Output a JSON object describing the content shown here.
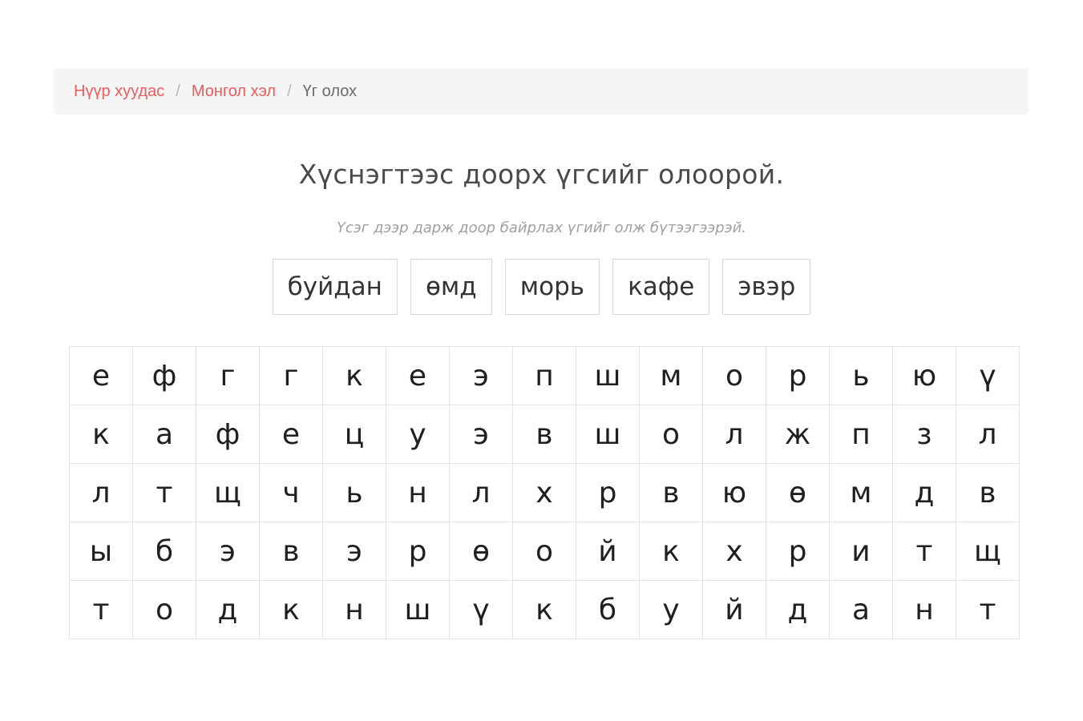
{
  "breadcrumb": {
    "items": [
      {
        "label": "Нүүр хуудас"
      },
      {
        "label": "Монгол хэл"
      }
    ],
    "separator": "/",
    "current": "Үг олох"
  },
  "title": "Хүснэгтээс доорх үгсийг олоорой.",
  "subtitle": "Үсэг дээр дарж доор байрлах үгийг олж бүтээгээрэй.",
  "words": [
    "буйдан",
    "өмд",
    "морь",
    "кафе",
    "эвэр"
  ],
  "grid": [
    [
      "е",
      "ф",
      "г",
      "г",
      "к",
      "е",
      "э",
      "п",
      "ш",
      "м",
      "о",
      "р",
      "ь",
      "ю",
      "ү"
    ],
    [
      "к",
      "а",
      "ф",
      "е",
      "ц",
      "у",
      "э",
      "в",
      "ш",
      "о",
      "л",
      "ж",
      "п",
      "з",
      "л"
    ],
    [
      "л",
      "т",
      "щ",
      "ч",
      "ь",
      "н",
      "л",
      "х",
      "р",
      "в",
      "ю",
      "ө",
      "м",
      "д",
      "в"
    ],
    [
      "ы",
      "б",
      "э",
      "в",
      "э",
      "р",
      "ө",
      "о",
      "й",
      "к",
      "х",
      "р",
      "и",
      "т",
      "щ"
    ],
    [
      "т",
      "о",
      "д",
      "к",
      "н",
      "ш",
      "ү",
      "к",
      "б",
      "у",
      "й",
      "д",
      "а",
      "н",
      "т"
    ]
  ]
}
